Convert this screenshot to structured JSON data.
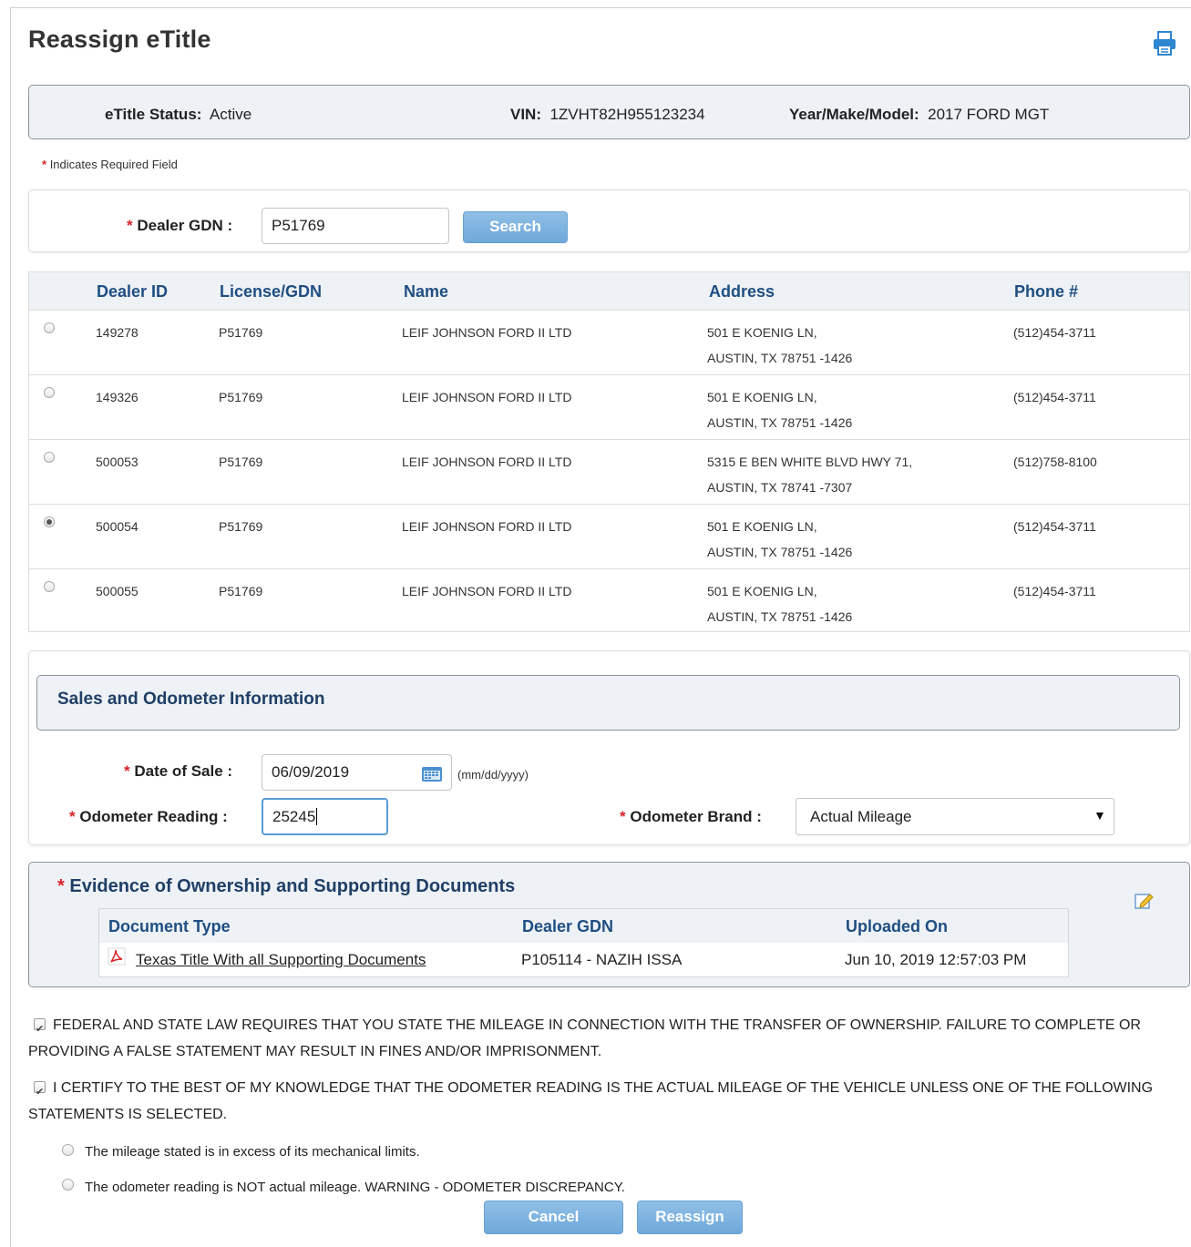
{
  "page": {
    "title": "Reassign eTitle"
  },
  "icons": {
    "print": "printer-icon",
    "calendar": "calendar-icon",
    "pdf": "pdf-icon",
    "edit": "edit-icon"
  },
  "status": {
    "status_label": "eTitle Status:",
    "status_value": "Active",
    "vin_label": "VIN:",
    "vin_value": "1ZVHT82H955123234",
    "ymm_label": "Year/Make/Model:",
    "ymm_value": "2017 FORD MGT"
  },
  "required_note": {
    "asterisk": "*",
    "text": "Indicates Required Field"
  },
  "search": {
    "label": "Dealer GDN :",
    "value": "P51769",
    "button": "Search"
  },
  "dealers": {
    "headers": [
      "Dealer ID",
      "License/GDN",
      "Name",
      "Address",
      "Phone #"
    ],
    "rows": [
      {
        "id": "149278",
        "gdn": "P51769",
        "name": "LEIF JOHNSON FORD II LTD",
        "addr1": "501 E KOENIG LN,",
        "addr2": "AUSTIN, TX 78751 -1426",
        "phone": "(512)454-3711",
        "selected": false
      },
      {
        "id": "149326",
        "gdn": "P51769",
        "name": "LEIF JOHNSON FORD II LTD",
        "addr1": "501 E KOENIG LN,",
        "addr2": "AUSTIN, TX 78751 -1426",
        "phone": "(512)454-3711",
        "selected": false
      },
      {
        "id": "500053",
        "gdn": "P51769",
        "name": "LEIF JOHNSON FORD II LTD",
        "addr1": "5315 E BEN WHITE BLVD HWY 71,",
        "addr2": "AUSTIN, TX 78741 -7307",
        "phone": "(512)758-8100",
        "selected": false
      },
      {
        "id": "500054",
        "gdn": "P51769",
        "name": "LEIF JOHNSON FORD II LTD",
        "addr1": "501 E KOENIG LN,",
        "addr2": "AUSTIN, TX 78751 -1426",
        "phone": "(512)454-3711",
        "selected": true
      },
      {
        "id": "500055",
        "gdn": "P51769",
        "name": "LEIF JOHNSON FORD II LTD",
        "addr1": "501 E KOENIG LN,",
        "addr2": "AUSTIN, TX 78751 -1426",
        "phone": "(512)454-3711",
        "selected": false
      }
    ]
  },
  "sales": {
    "title": "Sales and Odometer Information",
    "date_label": "Date of Sale :",
    "date_value": "06/09/2019",
    "date_hint": "(mm/dd/yyyy)",
    "odometer_label": "Odometer Reading :",
    "odometer_value": "25245",
    "brand_label": "Odometer Brand :",
    "brand_value": "Actual Mileage",
    "brand_arrow": "▼"
  },
  "evidence": {
    "title": "Evidence of Ownership and Supporting Documents",
    "headers": [
      "Document Type",
      "Dealer GDN",
      "Uploaded On"
    ],
    "rows": [
      {
        "type": "Texas Title With all Supporting Documents",
        "gdn": "P105114 - NAZIH ISSA",
        "uploaded": "Jun 10, 2019 12:57:03 PM"
      }
    ]
  },
  "certifications": {
    "federal": "FEDERAL AND STATE LAW REQUIRES THAT YOU STATE THE MILEAGE IN CONNECTION WITH THE TRANSFER OF OWNERSHIP. FAILURE TO COMPLETE OR PROVIDING A FALSE STATEMENT MAY RESULT IN FINES AND/OR IMPRISONMENT.",
    "certify": "I CERTIFY TO THE BEST OF MY KNOWLEDGE THAT THE ODOMETER READING IS THE ACTUAL MILEAGE OF THE VEHICLE UNLESS ONE OF THE FOLLOWING STATEMENTS IS SELECTED.",
    "statement1": "The mileage stated is in excess of its mechanical limits.",
    "statement2": "The odometer reading is NOT actual mileage. WARNING - ODOMETER DISCREPANCY."
  },
  "actions": {
    "cancel": "Cancel",
    "reassign": "Reassign"
  },
  "colors": {
    "accent": "#6fa8da",
    "header_text": "#1f4e82",
    "panel_bg": "#eef2f6",
    "required": "#d9232a"
  }
}
